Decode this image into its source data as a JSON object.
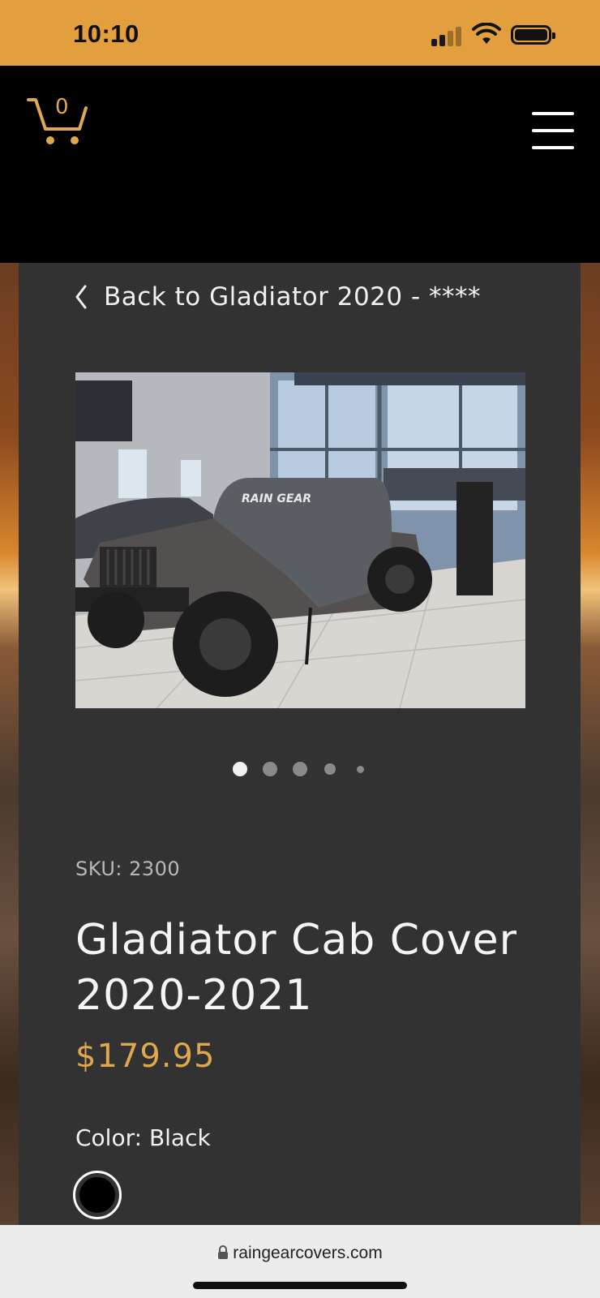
{
  "status_bar": {
    "time": "10:10",
    "signal_bars": 2,
    "battery": "full"
  },
  "header": {
    "cart_count": "0",
    "cart_icon": "shopping-cart-icon",
    "menu_icon": "hamburger-menu-icon"
  },
  "back_link": {
    "label": "Back to Gladiator 2020 - ****"
  },
  "gallery": {
    "image_count": 5,
    "active_index": 0,
    "cover_text": "RAIN GEAR"
  },
  "product": {
    "sku": "SKU: 2300",
    "title": "Gladiator Cab Cover 2020-2021",
    "price": "$179.95",
    "color_label": "Color: Black",
    "swatch_color": "#000000"
  },
  "browser": {
    "url": "raingearcovers.com"
  },
  "colors": {
    "accent": "#e0a84e",
    "status_bar": "#e39f3e",
    "card": "#323232"
  }
}
